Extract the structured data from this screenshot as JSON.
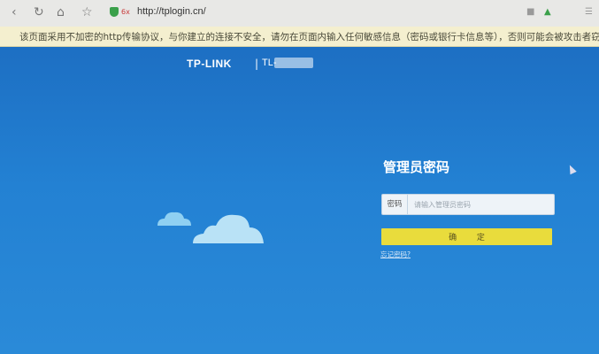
{
  "browser": {
    "url": "http://tplogin.cn/",
    "security_badge": "6x",
    "icons": [
      "back-icon",
      "reload-icon",
      "home-icon",
      "star-icon",
      "shield-icon"
    ]
  },
  "banner": {
    "text": "该页面采用不加密的http传输协议，与你建立的连接不安全，请勿在页面内输入任何敏感信息（密码或银行卡信息等），否则可能会被攻击者窃取"
  },
  "header": {
    "logo": "TP-LINK",
    "separator": "|",
    "model_prefix": "TL-"
  },
  "login": {
    "title": "管理员密码",
    "password_label": "密码",
    "password_placeholder": "请输入管理员密码",
    "confirm_label": "确 定",
    "forgot_link": "忘记密码?"
  },
  "colors": {
    "page_bg": "#1e75c8",
    "button_bg": "#e9dc3c",
    "banner_bg": "#f4efcf"
  }
}
